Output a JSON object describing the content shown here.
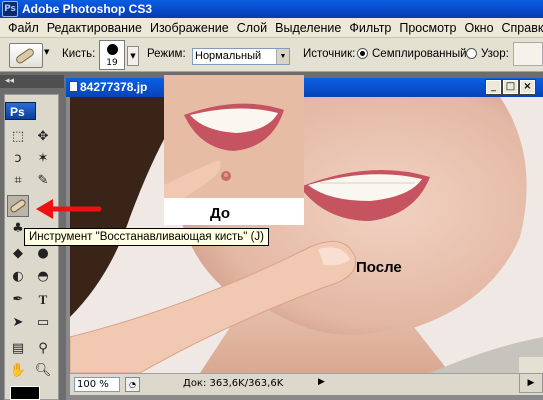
{
  "window": {
    "title": "Adobe Photoshop CS3",
    "app_icon_label": "Ps"
  },
  "menu": [
    "Файл",
    "Редактирование",
    "Изображение",
    "Слой",
    "Выделение",
    "Фильтр",
    "Просмотр",
    "Окно",
    "Справка"
  ],
  "options": {
    "brush_label": "Кисть:",
    "brush_size": "19",
    "mode_label": "Режим:",
    "mode_value": "Нормальный",
    "source_label": "Источник:",
    "source_sampled": "Семплированный",
    "source_pattern": "Узор:"
  },
  "toolbox": {
    "logo": "Ps",
    "collapse": "◂◂"
  },
  "document": {
    "title": "84277378.jp",
    "zoom": "100 %",
    "info": "Док: 363,6K/363,6K"
  },
  "image": {
    "before_label": "До",
    "after_label": "После"
  },
  "tooltip": "Инструмент \"Восстанавливающая кисть\" (J)",
  "colors": {
    "accent_arrow": "#ee1111",
    "title_blue": "#0548c8"
  }
}
